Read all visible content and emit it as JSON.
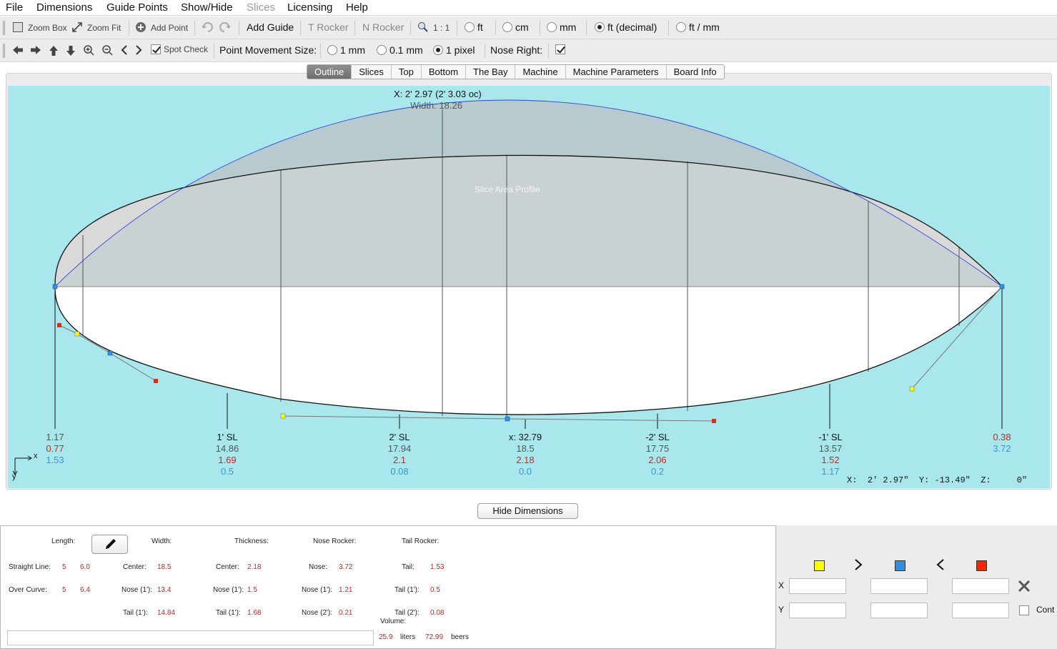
{
  "menubar": {
    "items": [
      "File",
      "Dimensions",
      "Guide Points",
      "Show/Hide",
      "Slices",
      "Licensing",
      "Help"
    ],
    "disabled_index": 4
  },
  "toolbar1": {
    "zoom_box": "Zoom Box",
    "zoom_fit": "Zoom Fit",
    "add_point": "Add Point",
    "add_guide": "Add Guide",
    "t_rocker": "T Rocker",
    "n_rocker": "N Rocker",
    "scale": "1 : 1",
    "units": [
      {
        "label": "ft",
        "selected": false
      },
      {
        "label": "cm",
        "selected": false
      },
      {
        "label": "mm",
        "selected": false
      },
      {
        "label": "ft (decimal)",
        "selected": true
      },
      {
        "label": "ft / mm",
        "selected": false
      }
    ]
  },
  "toolbar2": {
    "spot_check": "Spot Check",
    "spot_check_checked": true,
    "point_movement_label": "Point Movement Size:",
    "movement_options": [
      {
        "label": "1 mm",
        "selected": false
      },
      {
        "label": "0.1 mm",
        "selected": false
      },
      {
        "label": "1 pixel",
        "selected": true
      }
    ],
    "nose_right_label": "Nose Right:",
    "nose_right_checked": true
  },
  "tabs": [
    "Outline",
    "Slices",
    "Top",
    "Bottom",
    "The Bay",
    "Machine",
    "Machine Parameters",
    "Board Info"
  ],
  "active_tab": 0,
  "canvas": {
    "background": "#a8e8ed",
    "readout_top": "X: 2' 2.97 (2' 3.03 oc)",
    "width_top": "Width: 18.26",
    "slice_area_label": "Slice Area Profile",
    "axis_x": "x",
    "axis_y": "y",
    "columns": [
      {
        "title": "",
        "length": "1.17",
        "red": "0.77",
        "blue": "1.53"
      },
      {
        "title": "1' SL",
        "length": "14.86",
        "red": "1.69",
        "blue": "0.5"
      },
      {
        "title": "2' SL",
        "length": "17.94",
        "red": "2.1",
        "blue": "0.08"
      },
      {
        "title": "x: 32.79",
        "length": "18.5",
        "red": "2.18",
        "blue": "0.0"
      },
      {
        "title": "-2' SL",
        "length": "17.75",
        "red": "2.06",
        "blue": "0.2"
      },
      {
        "title": "-1' SL",
        "length": "13.57",
        "red": "1.52",
        "blue": "1.17"
      },
      {
        "title": "",
        "length": "",
        "red": "0.38",
        "blue": "3.72"
      }
    ],
    "coords_x_label": "X:",
    "coords_x": "2' 2.97\"",
    "coords_y_label": "Y:",
    "coords_y": "-13.49\"",
    "coords_z_label": "Z:",
    "coords_z": "0\""
  },
  "hide_dimensions": "Hide Dimensions",
  "dimensions": {
    "length_label": "Length:",
    "width_label": "Width:",
    "thickness_label": "Thickness:",
    "nose_rocker_label": "Nose Rocker:",
    "tail_rocker_label": "Tail Rocker:",
    "straight_line_label": "Straight Line:",
    "straight_line_ft": "5",
    "straight_line_in": "6.0",
    "over_curve_label": "Over Curve:",
    "over_curve_ft": "5",
    "over_curve_in": "6.4",
    "width_center_label": "Center:",
    "width_center": "18.5",
    "width_nose_label": "Nose (1'):",
    "width_nose": "13.4",
    "width_tail_label": "Tail (1'):",
    "width_tail": "14.84",
    "thick_center_label": "Center:",
    "thick_center": "2.18",
    "thick_nose_label": "Nose (1'):",
    "thick_nose": "1.5",
    "thick_tail_label": "Tail (1'):",
    "thick_tail": "1.68",
    "nr_nose_label": "Nose:",
    "nr_nose": "3.72",
    "nr_nose1_label": "Nose (1'):",
    "nr_nose1": "1.21",
    "nr_nose2_label": "Nose (2'):",
    "nr_nose2": "0.21",
    "tr_tail_label": "Tail:",
    "tr_tail": "1.53",
    "tr_tail1_label": "Tail (1'):",
    "tr_tail1": "0.5",
    "tr_tail2_label": "Tail (2'):",
    "tr_tail2": "0.08",
    "volume_label": "Volume:",
    "volume_liters": "25.9",
    "liters_label": "liters",
    "volume_beers": "72.99",
    "beers_label": "beers"
  },
  "control_panel": {
    "x_label": "X",
    "y_label": "Y",
    "swatch_colors": [
      "#ffff00",
      "#2f8fe0",
      "#ff2200"
    ],
    "cont_label": "Cont"
  }
}
